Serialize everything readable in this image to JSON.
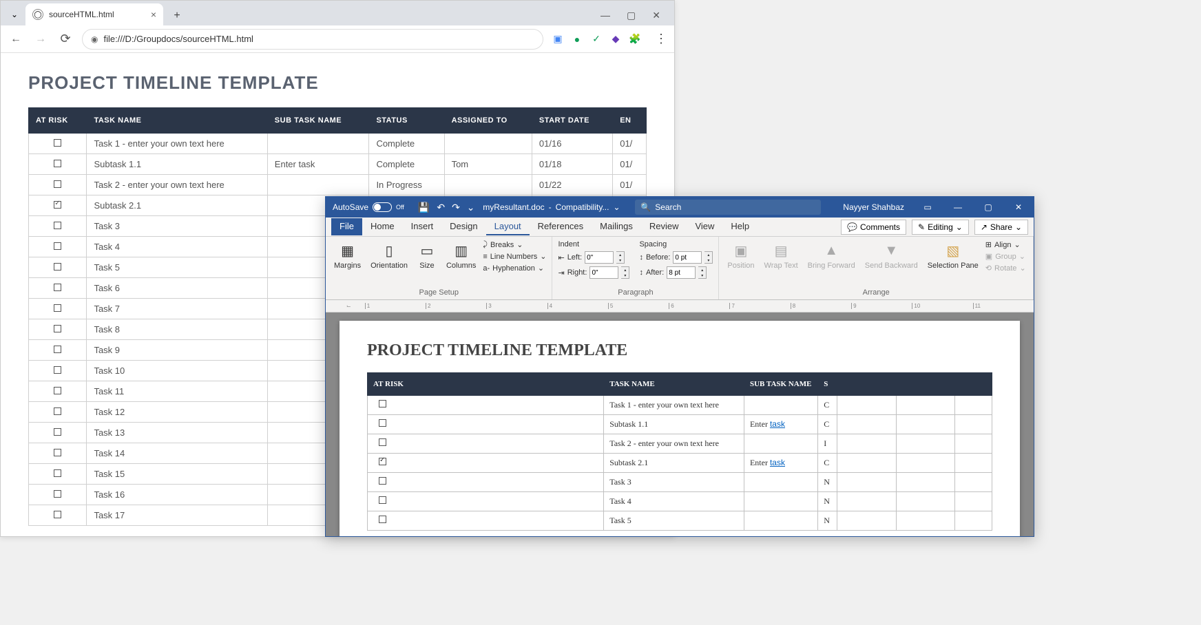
{
  "browser": {
    "tab_title": "sourceHTML.html",
    "address": "file:///D:/Groupdocs/sourceHTML.html",
    "search_placeholder": "Search"
  },
  "page": {
    "title": "PROJECT TIMELINE TEMPLATE",
    "headers": [
      "AT RISK",
      "TASK NAME",
      "SUB TASK NAME",
      "STATUS",
      "ASSIGNED TO",
      "START DATE",
      "EN"
    ],
    "rows": [
      {
        "chk": false,
        "task": "Task 1 - enter your own text here",
        "sub": "",
        "status": "Complete",
        "assigned": "",
        "start": "01/16",
        "end": "01/"
      },
      {
        "chk": false,
        "task": "Subtask 1.1",
        "sub": "Enter task",
        "status": "Complete",
        "assigned": "Tom",
        "start": "01/18",
        "end": "01/"
      },
      {
        "chk": false,
        "task": "Task 2 - enter your own text here",
        "sub": "",
        "status": "In Progress",
        "assigned": "",
        "start": "01/22",
        "end": "01/"
      },
      {
        "chk": true,
        "task": "Subtask 2.1",
        "sub": "",
        "status": "",
        "assigned": "",
        "start": "",
        "end": ""
      },
      {
        "chk": false,
        "task": "Task 3",
        "sub": "",
        "status": "",
        "assigned": "",
        "start": "",
        "end": ""
      },
      {
        "chk": false,
        "task": "Task 4",
        "sub": "",
        "status": "",
        "assigned": "",
        "start": "",
        "end": ""
      },
      {
        "chk": false,
        "task": "Task 5",
        "sub": "",
        "status": "",
        "assigned": "",
        "start": "",
        "end": ""
      },
      {
        "chk": false,
        "task": "Task 6",
        "sub": "",
        "status": "",
        "assigned": "",
        "start": "",
        "end": ""
      },
      {
        "chk": false,
        "task": "Task 7",
        "sub": "",
        "status": "",
        "assigned": "",
        "start": "",
        "end": ""
      },
      {
        "chk": false,
        "task": "Task 8",
        "sub": "",
        "status": "",
        "assigned": "",
        "start": "",
        "end": ""
      },
      {
        "chk": false,
        "task": "Task 9",
        "sub": "",
        "status": "",
        "assigned": "",
        "start": "",
        "end": ""
      },
      {
        "chk": false,
        "task": "Task 10",
        "sub": "",
        "status": "",
        "assigned": "",
        "start": "",
        "end": ""
      },
      {
        "chk": false,
        "task": "Task 11",
        "sub": "",
        "status": "",
        "assigned": "",
        "start": "",
        "end": ""
      },
      {
        "chk": false,
        "task": "Task 12",
        "sub": "",
        "status": "",
        "assigned": "",
        "start": "",
        "end": ""
      },
      {
        "chk": false,
        "task": "Task 13",
        "sub": "",
        "status": "",
        "assigned": "",
        "start": "",
        "end": ""
      },
      {
        "chk": false,
        "task": "Task 14",
        "sub": "",
        "status": "",
        "assigned": "",
        "start": "",
        "end": ""
      },
      {
        "chk": false,
        "task": "Task 15",
        "sub": "",
        "status": "",
        "assigned": "",
        "start": "",
        "end": ""
      },
      {
        "chk": false,
        "task": "Task 16",
        "sub": "",
        "status": "",
        "assigned": "",
        "start": "",
        "end": ""
      },
      {
        "chk": false,
        "task": "Task 17",
        "sub": "",
        "status": "",
        "assigned": "",
        "start": "",
        "end": ""
      }
    ]
  },
  "word": {
    "autosave": "AutoSave",
    "autosave_state": "Off",
    "doc_name": "myResultant.doc",
    "compat": "Compatibility...",
    "search_placeholder": "Search",
    "user": "Nayyer Shahbaz",
    "tabs": [
      "File",
      "Home",
      "Insert",
      "Design",
      "Layout",
      "References",
      "Mailings",
      "Review",
      "View",
      "Help"
    ],
    "active_tab": "Layout",
    "comments": "Comments",
    "editing": "Editing",
    "share": "Share",
    "ribbon": {
      "page_setup": {
        "label": "Page Setup",
        "margins": "Margins",
        "orientation": "Orientation",
        "size": "Size",
        "columns": "Columns",
        "breaks": "Breaks",
        "line_numbers": "Line Numbers",
        "hyphenation": "Hyphenation"
      },
      "paragraph": {
        "label": "Paragraph",
        "indent": "Indent",
        "left": "Left:",
        "right": "Right:",
        "left_val": "0\"",
        "right_val": "0\"",
        "spacing": "Spacing",
        "before": "Before:",
        "after": "After:",
        "before_val": "0 pt",
        "after_val": "8 pt"
      },
      "arrange": {
        "label": "Arrange",
        "position": "Position",
        "wrap": "Wrap Text",
        "bring": "Bring Forward",
        "send": "Send Backward",
        "selection": "Selection Pane",
        "align": "Align",
        "group": "Group",
        "rotate": "Rotate"
      }
    },
    "doc": {
      "title": "PROJECT TIMELINE TEMPLATE",
      "headers": [
        "AT RISK",
        "TASK NAME",
        "SUB TASK NAME",
        "S",
        "",
        "",
        ""
      ],
      "rows": [
        {
          "chk": false,
          "task": "Task 1 - enter your own text here",
          "sub": "",
          "s": "C"
        },
        {
          "chk": false,
          "task": "Subtask 1.1",
          "sub": "Enter task",
          "s": "C",
          "link": true
        },
        {
          "chk": false,
          "task": "Task 2 - enter your own text here",
          "sub": "",
          "s": "I"
        },
        {
          "chk": true,
          "task": "Subtask 2.1",
          "sub": "Enter task",
          "s": "C",
          "link": true
        },
        {
          "chk": false,
          "task": "Task 3",
          "sub": "",
          "s": "N"
        },
        {
          "chk": false,
          "task": "Task 4",
          "sub": "",
          "s": "N"
        },
        {
          "chk": false,
          "task": "Task 5",
          "sub": "",
          "s": "N"
        }
      ]
    }
  }
}
